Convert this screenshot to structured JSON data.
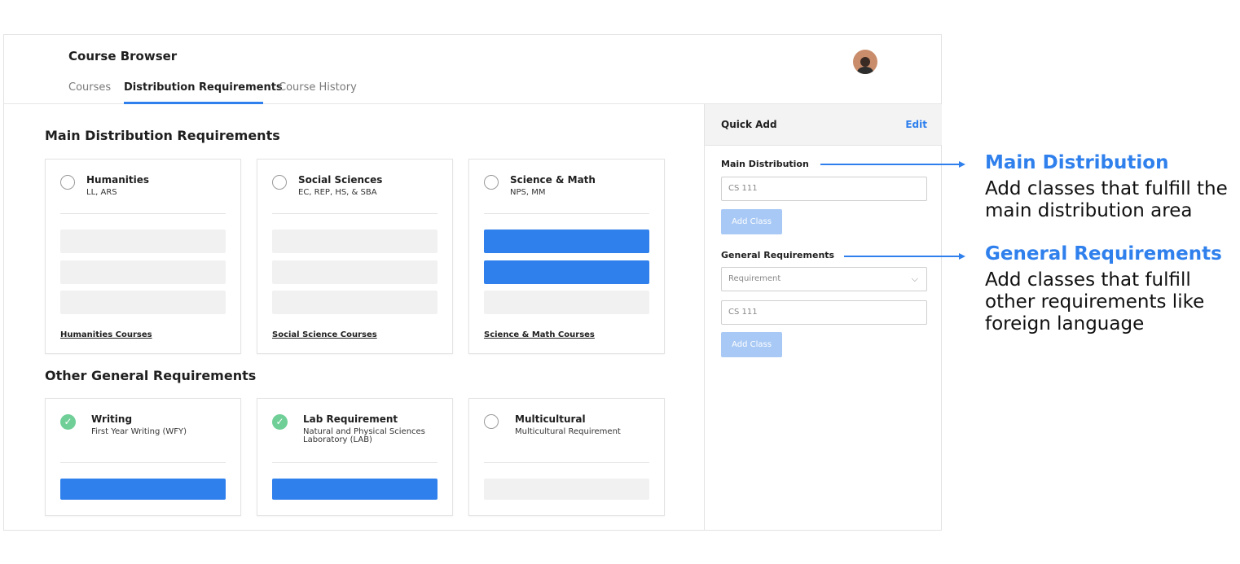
{
  "app": {
    "title": "Course Browser"
  },
  "tabs": [
    {
      "label": "Courses",
      "active": false
    },
    {
      "label": "Distribution Requirements",
      "active": true
    },
    {
      "label": "Course History",
      "active": false
    }
  ],
  "main": {
    "main_section_title": "Main Distribution Requirements",
    "main_cards": [
      {
        "title": "Humanities",
        "subtitle": "LL, ARS",
        "link": "Humanities Courses",
        "completed": false,
        "filled_bars": 0,
        "total_bars": 3
      },
      {
        "title": "Social Sciences",
        "subtitle": "EC, REP, HS, & SBA",
        "link": "Social Science Courses",
        "completed": false,
        "filled_bars": 0,
        "total_bars": 3
      },
      {
        "title": "Science & Math",
        "subtitle": "NPS, MM",
        "link": "Science & Math Courses",
        "completed": false,
        "filled_bars": 2,
        "total_bars": 3
      }
    ],
    "other_section_title": "Other General Requirements",
    "other_cards": [
      {
        "title": "Writing",
        "subtitle": "First Year Writing (WFY)",
        "completed": true,
        "filled_bars": 1,
        "total_bars": 1
      },
      {
        "title": "Lab Requirement",
        "subtitle": "Natural and Physical Sciences Laboratory (LAB)",
        "completed": true,
        "filled_bars": 1,
        "total_bars": 1
      },
      {
        "title": "Multicultural",
        "subtitle": "Multicultural Requirement",
        "completed": false,
        "filled_bars": 0,
        "total_bars": 1
      }
    ]
  },
  "quick_add": {
    "title": "Quick Add",
    "edit_label": "Edit",
    "main_label": "Main Distribution",
    "main_input_placeholder": "CS 111",
    "add_class_label": "Add Class",
    "general_label": "General Requirements",
    "requirement_select": "Requirement",
    "general_input_placeholder": "CS 111"
  },
  "annotations": {
    "main_title": "Main Distribution",
    "main_body": "Add classes that fulfill the main distribution area",
    "general_title": "General Requirements",
    "general_body": "Add classes that fulfill other requirements like foreign language"
  },
  "colors": {
    "accent": "#2f80ed",
    "success": "#6fcf97",
    "disabled_button": "#a8c9f5"
  }
}
